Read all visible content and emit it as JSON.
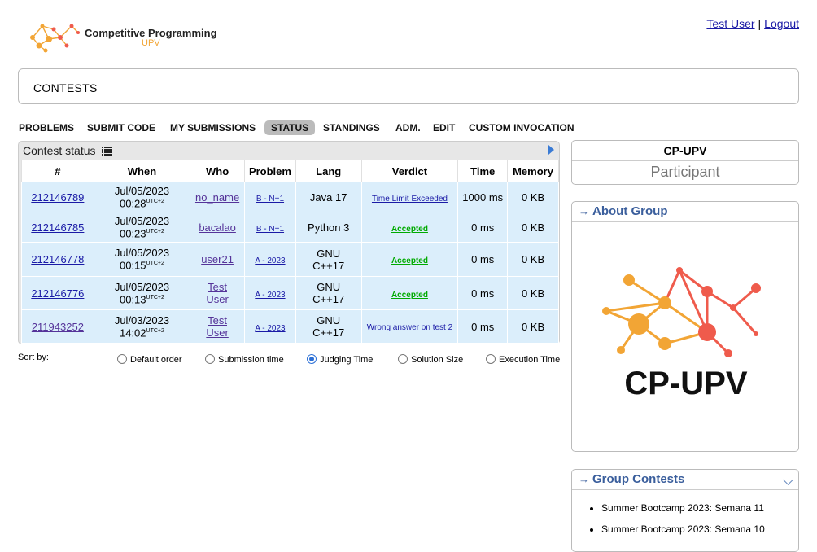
{
  "header": {
    "logo_title": "Competitive Programming",
    "logo_sub": "UPV",
    "user_link": "Test User",
    "separator": "|",
    "logout": "Logout"
  },
  "page_title": "CONTESTS",
  "menu": [
    "PROBLEMS",
    "SUBMIT CODE",
    "MY SUBMISSIONS",
    "STATUS",
    "STANDINGS",
    "ADM.",
    "EDIT",
    "CUSTOM INVOCATION"
  ],
  "active_menu": "STATUS",
  "status_panel": {
    "title": "Contest status",
    "columns": [
      "#",
      "When",
      "Who",
      "Problem",
      "Lang",
      "Verdict",
      "Time",
      "Memory"
    ],
    "rows": [
      {
        "id": "212146789",
        "date": "Jul/05/2023",
        "time": "00:28",
        "tz": "UTC+2",
        "who": "no_name",
        "problem": "B - N+1",
        "lang": "Java 17",
        "verdict": "Time Limit Exceeded",
        "verdict_type": "tle",
        "time_ms": "1000 ms",
        "memory": "0 KB"
      },
      {
        "id": "212146785",
        "date": "Jul/05/2023",
        "time": "00:23",
        "tz": "UTC+2",
        "who": "bacalao",
        "problem": "B - N+1",
        "lang": "Python 3",
        "verdict": "Accepted",
        "verdict_type": "ac",
        "time_ms": "0 ms",
        "memory": "0 KB"
      },
      {
        "id": "212146778",
        "date": "Jul/05/2023",
        "time": "00:15",
        "tz": "UTC+2",
        "who": "user21",
        "problem": "A - 2023",
        "lang": "GNU C++17",
        "verdict": "Accepted",
        "verdict_type": "ac",
        "time_ms": "0 ms",
        "memory": "0 KB"
      },
      {
        "id": "212146776",
        "date": "Jul/05/2023",
        "time": "00:13",
        "tz": "UTC+2",
        "who": "Test User",
        "problem": "A - 2023",
        "lang": "GNU C++17",
        "verdict": "Accepted",
        "verdict_type": "ac",
        "time_ms": "0 ms",
        "memory": "0 KB"
      },
      {
        "id": "211943252",
        "date": "Jul/03/2023",
        "time": "14:02",
        "tz": "UTC+2",
        "who": "Test User",
        "problem": "A - 2023",
        "lang": "GNU C++17",
        "verdict": "Wrong answer on test 2",
        "verdict_type": "wa",
        "time_ms": "0 ms",
        "memory": "0 KB"
      }
    ]
  },
  "sort": {
    "label": "Sort by:",
    "options": [
      "Default order",
      "Submission time",
      "Judging Time",
      "Solution Size",
      "Execution Time"
    ],
    "selected": "Judging Time"
  },
  "sidebar": {
    "group_name": "CP-UPV",
    "role": "Participant",
    "about_title": "About Group",
    "about_logo_text": "CP-UPV",
    "contests_title": "Group Contests",
    "contests": [
      "Summer Bootcamp 2023: Semana 11",
      "Summer Bootcamp 2023: Semana 10"
    ]
  },
  "colors": {
    "accent_orange": "#f2a535",
    "logo_red": "#ef5b4c",
    "row_bg": "#dbeefb",
    "accepted": "#00aa00",
    "link": "#1a1aa6",
    "box_head": "#3a5e9c"
  }
}
